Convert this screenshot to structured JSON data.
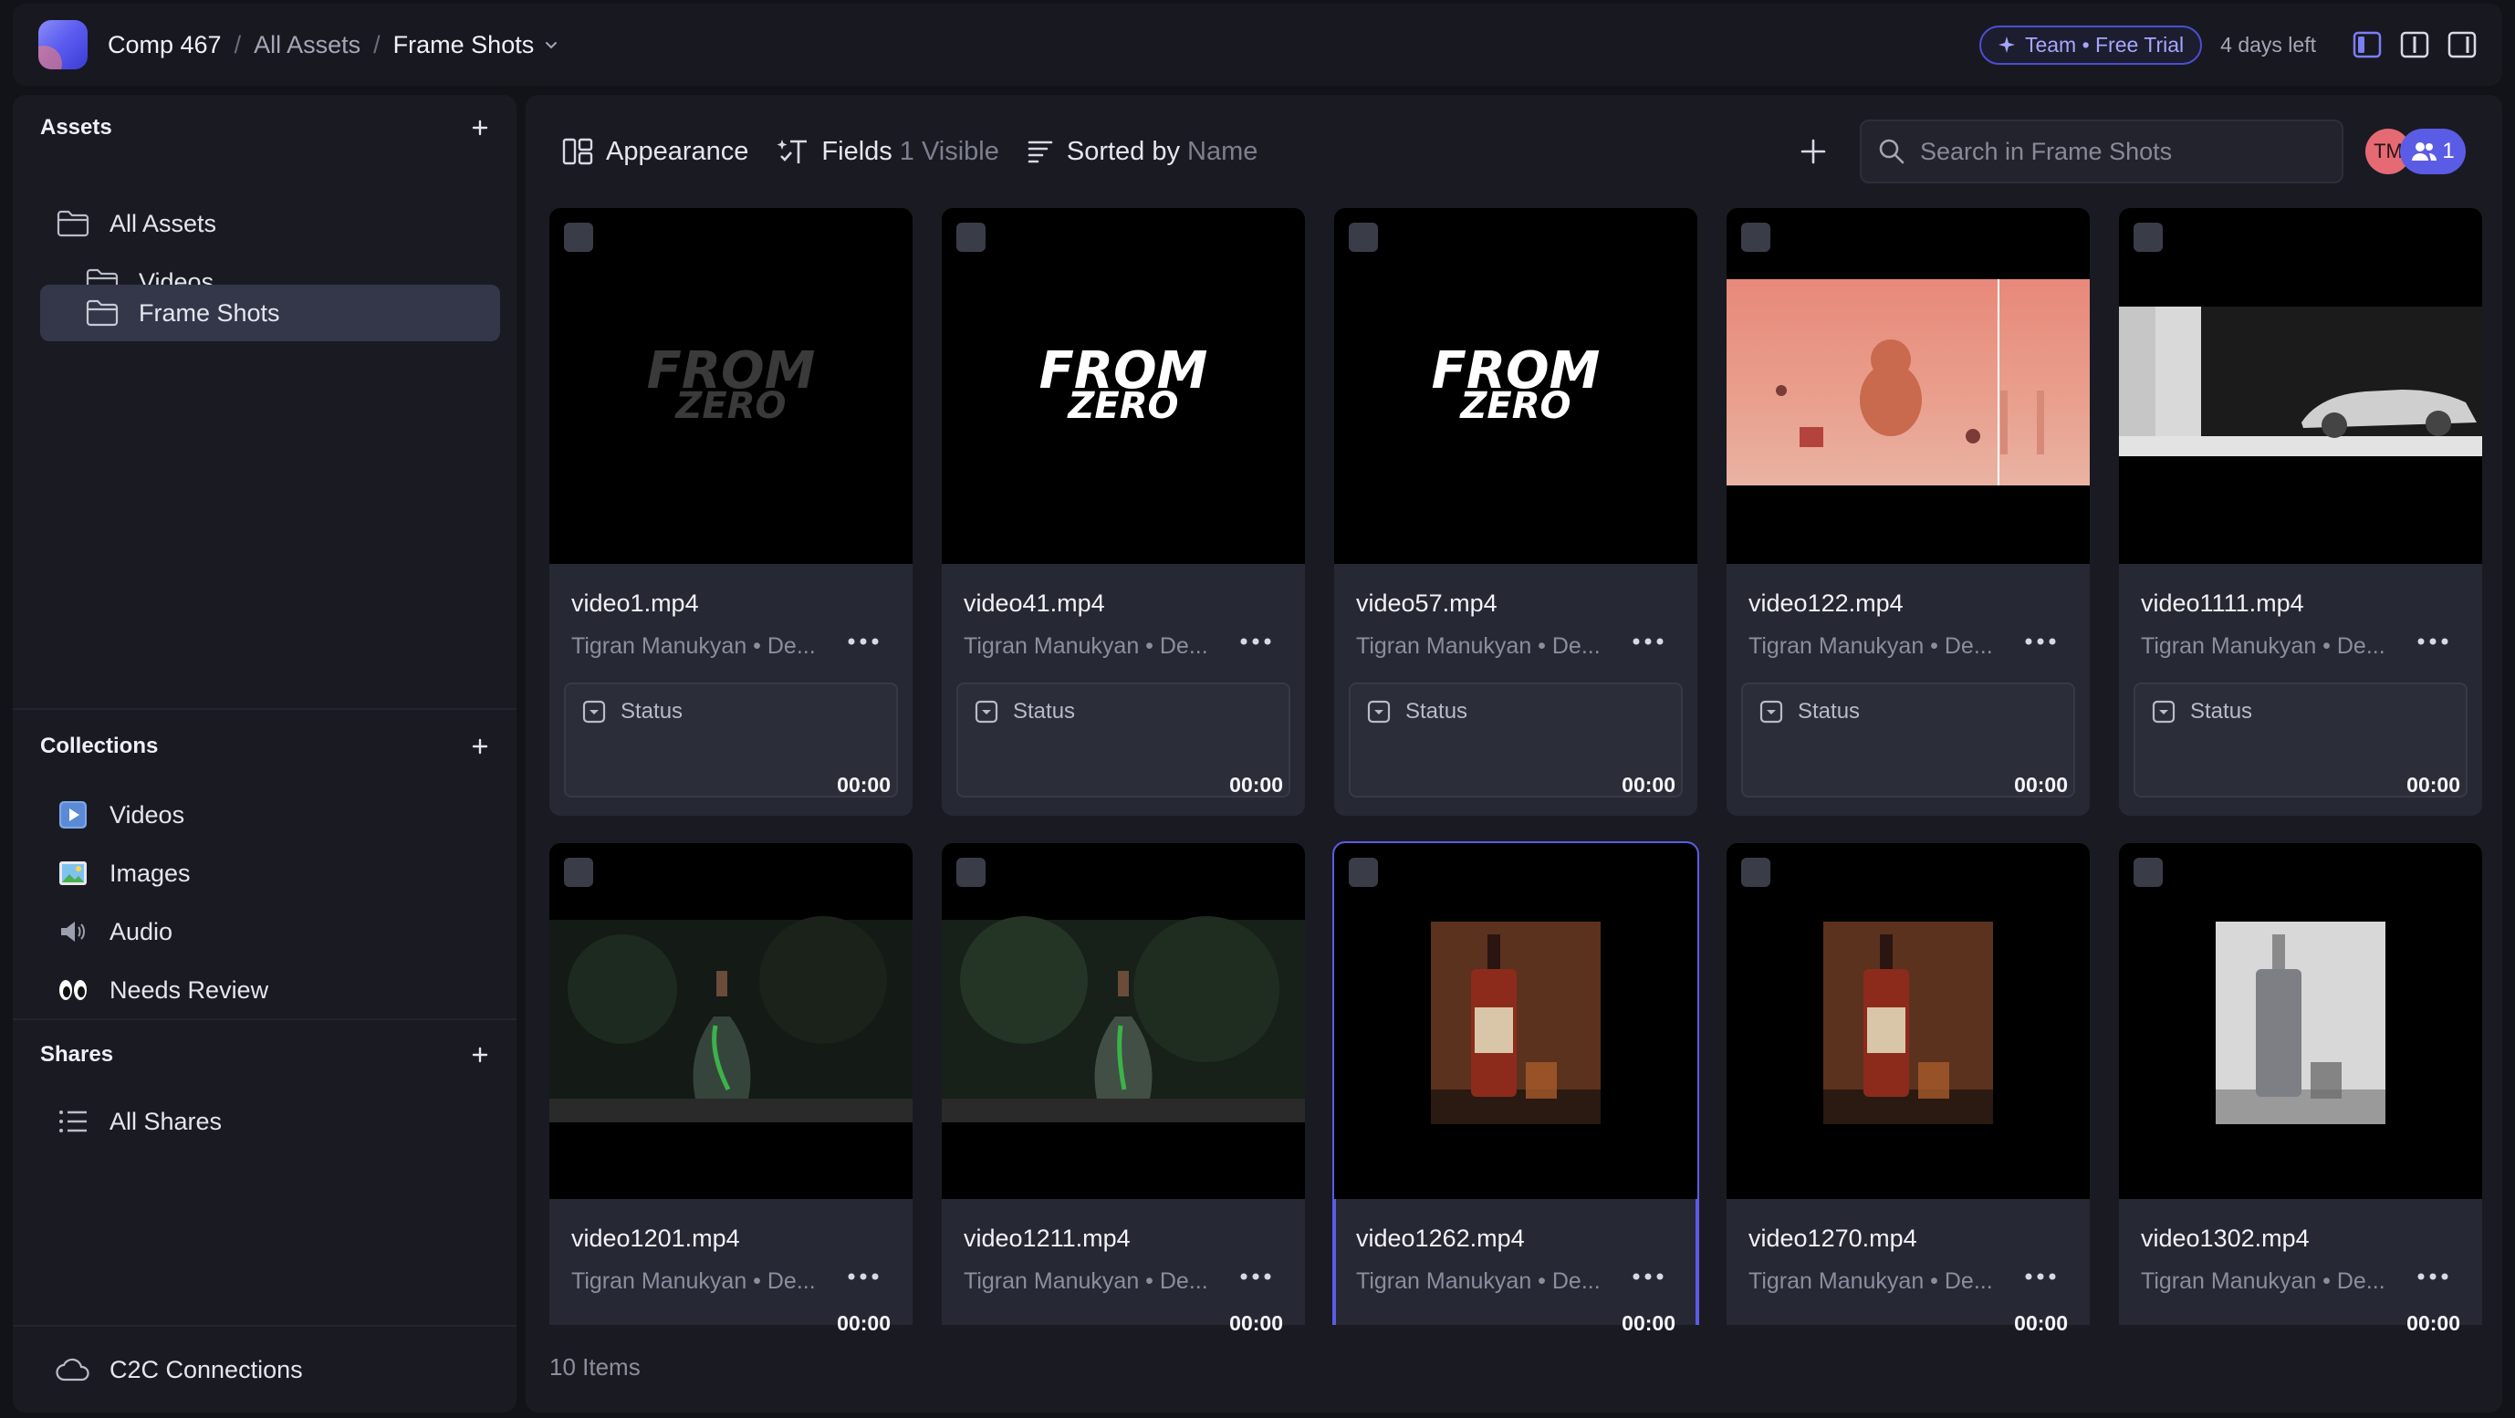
{
  "breadcrumb": {
    "workspace": "Comp 467",
    "parent": "All Assets",
    "current": "Frame Shots"
  },
  "plan": {
    "badge": "Team • Free Trial",
    "days_left": "4 days left",
    "accent": "#5b5ce6"
  },
  "sidebar": {
    "assets_title": "Assets",
    "assets": [
      {
        "label": "All Assets",
        "icon": "folder-icon"
      },
      {
        "label": "Videos",
        "icon": "folder-icon"
      },
      {
        "label": "Frame Shots",
        "icon": "folder-icon",
        "active": true
      }
    ],
    "collections_title": "Collections",
    "collections": [
      {
        "label": "Videos",
        "icon": "play-emoji-icon"
      },
      {
        "label": "Images",
        "icon": "picture-emoji-icon"
      },
      {
        "label": "Audio",
        "icon": "speaker-emoji-icon"
      },
      {
        "label": "Needs Review",
        "icon": "eyes-emoji-icon"
      }
    ],
    "shares_title": "Shares",
    "shares": [
      {
        "label": "All Shares",
        "icon": "list-icon"
      }
    ],
    "footer": {
      "label": "C2C Connections",
      "icon": "cloud-icon"
    }
  },
  "toolbar": {
    "appearance": "Appearance",
    "fields": "Fields",
    "fields_count": "1 Visible",
    "sorted_by": "Sorted by",
    "sort_field": "Name",
    "search_placeholder": "Search in Frame Shots",
    "avatar_initials": "TM",
    "members_count": "1"
  },
  "cards": [
    {
      "title": "video1.mp4",
      "meta": "Tigran Manukyan • De...",
      "duration": "00:00",
      "status": "Status",
      "thumb": "from-zero-dim"
    },
    {
      "title": "video41.mp4",
      "meta": "Tigran Manukyan • De...",
      "duration": "00:00",
      "status": "Status",
      "thumb": "from-zero"
    },
    {
      "title": "video57.mp4",
      "meta": "Tigran Manukyan • De...",
      "duration": "00:00",
      "status": "Status",
      "thumb": "from-zero"
    },
    {
      "title": "video122.mp4",
      "meta": "Tigran Manukyan • De...",
      "duration": "00:00",
      "status": "Status",
      "thumb": "pink-room"
    },
    {
      "title": "video1111.mp4",
      "meta": "Tigran Manukyan • De...",
      "duration": "00:00",
      "status": "Status",
      "thumb": "white-car"
    },
    {
      "title": "video1201.mp4",
      "meta": "Tigran Manukyan • De...",
      "duration": "00:00",
      "thumb": "glass-bottle"
    },
    {
      "title": "video1211.mp4",
      "meta": "Tigran Manukyan • De...",
      "duration": "00:00",
      "thumb": "glass-bottle"
    },
    {
      "title": "video1262.mp4",
      "meta": "Tigran Manukyan • De...",
      "duration": "00:00",
      "thumb": "whiskey-bottle",
      "selected": true
    },
    {
      "title": "video1270.mp4",
      "meta": "Tigran Manukyan • De...",
      "duration": "00:00",
      "thumb": "whiskey-bottle"
    },
    {
      "title": "video1302.mp4",
      "meta": "Tigran Manukyan • De...",
      "duration": "00:00",
      "thumb": "white-bottle"
    }
  ],
  "thumb_logo": {
    "line1": "FROM",
    "line2": "ZERO"
  },
  "footer": {
    "count": "10 Items"
  }
}
